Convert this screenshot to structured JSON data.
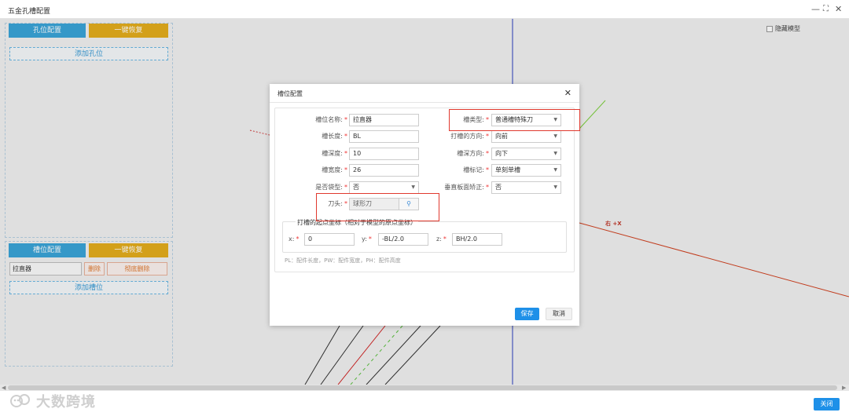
{
  "window": {
    "title": "五金孔槽配置"
  },
  "hole_panel": {
    "tab_config": "孔位配置",
    "tab_restore": "一键恢复",
    "add_button": "添加孔位"
  },
  "slot_panel": {
    "tab_config": "槽位配置",
    "tab_restore": "一键恢复",
    "slot_name_value": "拉直器",
    "delete_button": "删除",
    "delete_all_button": "彻底删除",
    "add_button": "添加槽位"
  },
  "scene": {
    "hide_model_label": "隐藏模型",
    "axis_label": "右 +X"
  },
  "dialog": {
    "title": "槽位配置",
    "fields": {
      "slot_name": {
        "label": "槽位名称:",
        "value": "拉直器"
      },
      "slot_type": {
        "label": "槽类型:",
        "value": "普通槽特殊刀"
      },
      "slot_length": {
        "label": "槽长度:",
        "value": "BL"
      },
      "slot_direction": {
        "label": "打槽的方向:",
        "value": "向前"
      },
      "slot_depth": {
        "label": "槽深度:",
        "value": "10"
      },
      "depth_direction": {
        "label": "槽深方向:",
        "value": "向下"
      },
      "slot_width": {
        "label": "槽宽度:",
        "value": "26"
      },
      "slot_mark": {
        "label": "槽标记:",
        "value": "单刻单槽"
      },
      "is_bag_type": {
        "label": "是否袋型:",
        "value": "否"
      },
      "vertical_correction": {
        "label": "垂直板面矫正:",
        "value": "否"
      },
      "cutter": {
        "label": "刀头:",
        "value": "球形刀"
      }
    },
    "coords": {
      "legend": "打槽的起点坐标（相对于模型的原点坐标）",
      "x_label": "x:",
      "x_value": "0",
      "y_label": "y:",
      "y_value": "-BL/2.0",
      "z_label": "z:",
      "z_value": "BH/2.0"
    },
    "hint": "PL：配件长度，PW：配件宽度，PH：配件高度",
    "save_button": "保存",
    "cancel_button": "取消"
  },
  "footer": {
    "close_button": "关闭",
    "watermark": "大数跨境"
  }
}
